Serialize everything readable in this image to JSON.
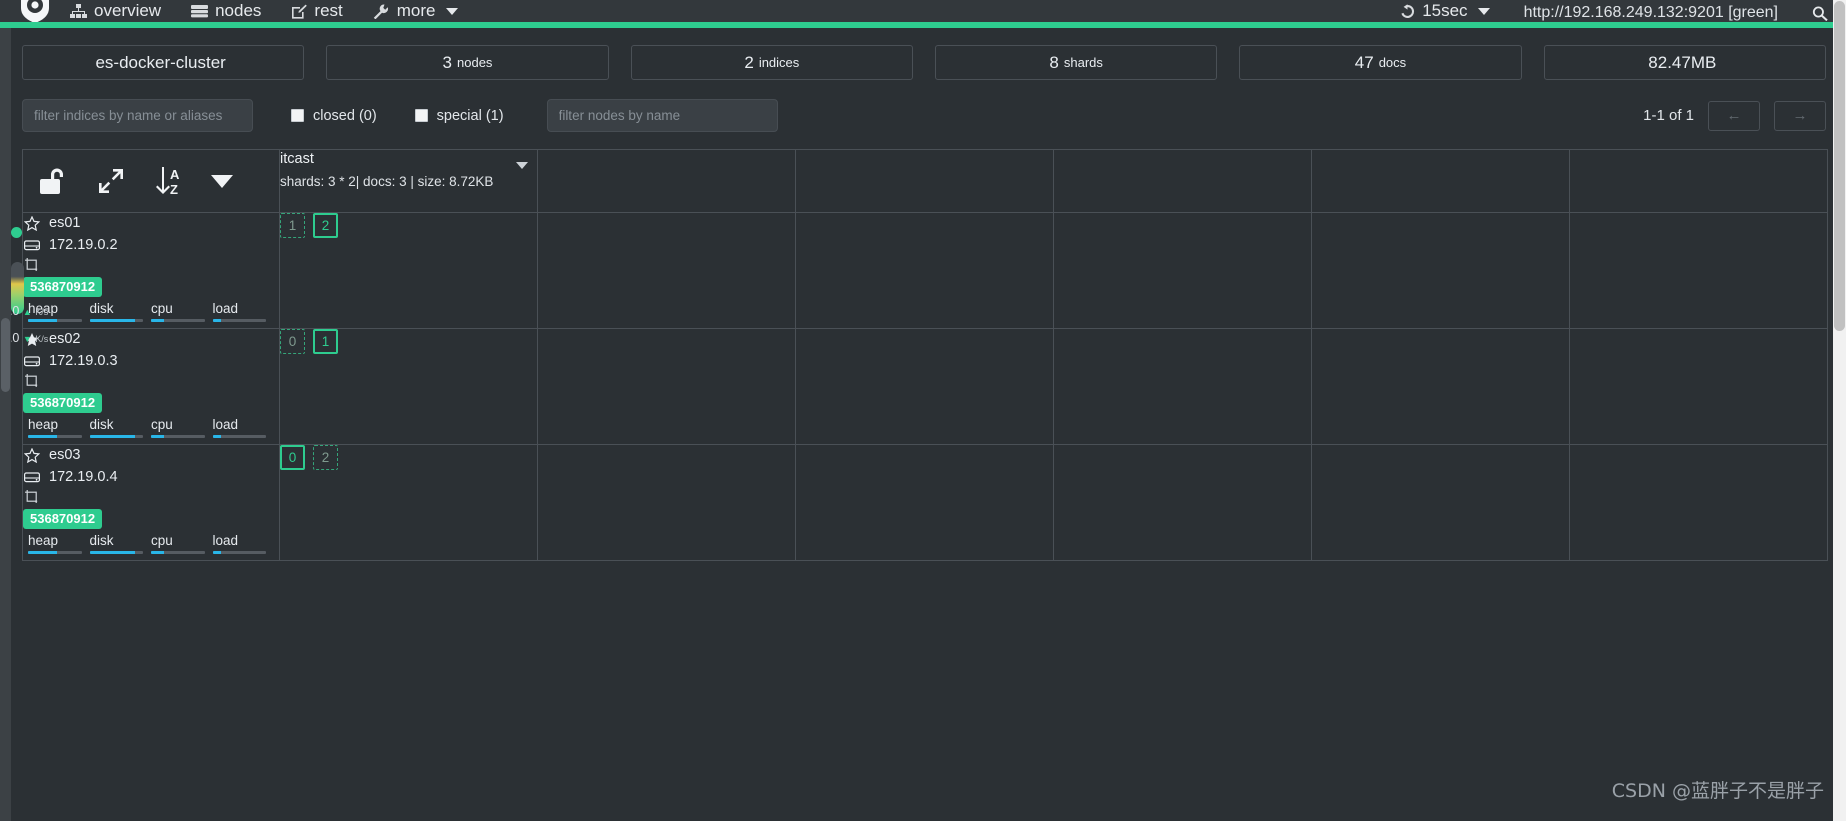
{
  "navbar": {
    "logo_icon": "cerebro-logo-icon",
    "items": [
      {
        "label": "overview",
        "icon": "sitemap-icon"
      },
      {
        "label": "nodes",
        "icon": "server-icon"
      },
      {
        "label": "rest",
        "icon": "pencil-square-icon"
      },
      {
        "label": "more",
        "icon": "wrench-icon",
        "has_caret": true
      }
    ],
    "refresh": {
      "label": "15sec",
      "icon": "refresh-icon",
      "has_caret": true
    },
    "connection_url": "http://192.168.249.132:9201 [green]",
    "search_icon": "search-icon"
  },
  "cluster_health_color": "#2ecc8f",
  "summary": [
    {
      "name": "cluster-name",
      "value": "es-docker-cluster",
      "unit": ""
    },
    {
      "name": "nodes-count",
      "value": "3",
      "unit": "nodes"
    },
    {
      "name": "indices-count",
      "value": "2",
      "unit": "indices"
    },
    {
      "name": "shards-count",
      "value": "8",
      "unit": "shards"
    },
    {
      "name": "docs-count",
      "value": "47",
      "unit": "docs"
    },
    {
      "name": "store-size",
      "value": "82.47MB",
      "unit": ""
    }
  ],
  "filters": {
    "indices_placeholder": "filter indices by name or aliases",
    "indices_value": "",
    "closed_label": "closed (0)",
    "closed_checked": false,
    "special_label": "special (1)",
    "special_checked": false,
    "nodes_placeholder": "filter nodes by name",
    "nodes_value": ""
  },
  "pager": {
    "range_label": "1-1 of 1",
    "prev_label": "←",
    "next_label": "→"
  },
  "toolbar": {
    "lock_icon": "unlock-icon",
    "expand_icon": "expand-arrows-icon",
    "sort_icon": "sort-alpha-down-icon",
    "menu_icon": "caret-down-icon"
  },
  "indices": [
    {
      "name": "itcast",
      "meta": "shards: 3 * 2| docs: 3 | size: 8.72KB",
      "caret_icon": "caret-down-icon"
    }
  ],
  "empty_columns": 5,
  "nodes": [
    {
      "name": "es01",
      "master": false,
      "star_icon": "star-outline-icon",
      "ip": "172.19.0.2",
      "ip_icon": "hdd-icon",
      "data_icon": "data-node-icon",
      "heap_badge": "536870912",
      "metrics": [
        {
          "label": "heap",
          "pct": 55
        },
        {
          "label": "disk",
          "pct": 85
        },
        {
          "label": "cpu",
          "pct": 25
        },
        {
          "label": "load",
          "pct": 15
        }
      ],
      "shards": [
        {
          "label": "1",
          "style": "dashed"
        },
        {
          "label": "2",
          "style": "solid"
        }
      ]
    },
    {
      "name": "es02",
      "master": true,
      "star_icon": "star-filled-icon",
      "ip": "172.19.0.3",
      "ip_icon": "hdd-icon",
      "data_icon": "data-node-icon",
      "heap_badge": "536870912",
      "metrics": [
        {
          "label": "heap",
          "pct": 55
        },
        {
          "label": "disk",
          "pct": 85
        },
        {
          "label": "cpu",
          "pct": 25
        },
        {
          "label": "load",
          "pct": 15
        }
      ],
      "shards": [
        {
          "label": "0",
          "style": "dashed"
        },
        {
          "label": "1",
          "style": "solid"
        }
      ]
    },
    {
      "name": "es03",
      "master": false,
      "star_icon": "star-outline-icon",
      "ip": "172.19.0.4",
      "ip_icon": "hdd-icon",
      "data_icon": "data-node-icon",
      "heap_badge": "536870912",
      "metrics": [
        {
          "label": "heap",
          "pct": 55
        },
        {
          "label": "disk",
          "pct": 85
        },
        {
          "label": "cpu",
          "pct": 25
        },
        {
          "label": "load",
          "pct": 15
        }
      ],
      "shards": [
        {
          "label": "0",
          "style": "solid"
        },
        {
          "label": "2",
          "style": "dashed"
        }
      ]
    }
  ],
  "gauge_overlay": {
    "status_dot_color": "#2ecc8f",
    "rate_in": "0.0",
    "rate_in_unit": "K/s",
    "rate_out": "0.0",
    "rate_out_unit": "K/s"
  },
  "watermark": "CSDN @蓝胖子不是胖子"
}
